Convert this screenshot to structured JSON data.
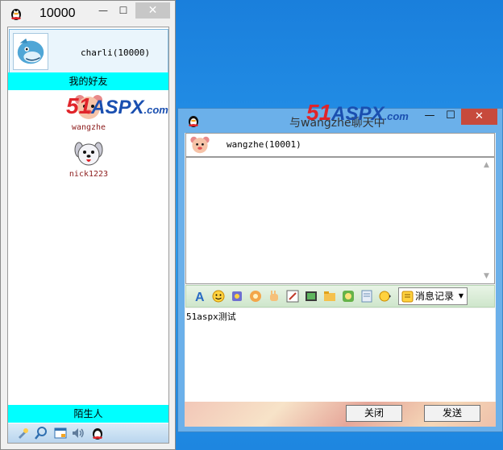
{
  "main_window": {
    "title": "10000",
    "min_label": "—",
    "max_label": "☐",
    "close_label": "✕",
    "me": {
      "name": "charli(10000)"
    },
    "friends_group": "我的好友",
    "friends": [
      {
        "name": "wangzhe"
      },
      {
        "name": "nick1223"
      }
    ],
    "strangers_group": "陌生人",
    "toolbar_icons": [
      "settings-icon",
      "search-icon",
      "manager-icon",
      "volume-icon",
      "qq-icon"
    ]
  },
  "watermarks": [
    {
      "num": "51",
      "brand": "ASPX",
      "suffix": ".com"
    },
    {
      "num": "51",
      "brand": "ASPX",
      "suffix": ".com"
    }
  ],
  "chat_window": {
    "title": "与wangzhe聊天中",
    "min_label": "—",
    "max_label": "☐",
    "close_label": "✕",
    "peer": {
      "name": "wangzhe(10001)"
    },
    "history_button": "消息记录",
    "input_value": "51aspx测试",
    "close_button": "关闭",
    "send_button": "发送",
    "format_icons": [
      "font-icon",
      "emoji-icon",
      "vibrate-icon",
      "magic-icon",
      "hand-icon",
      "edit-icon",
      "image-icon",
      "folder-icon",
      "sticker-icon",
      "template-icon",
      "voice-icon"
    ]
  },
  "colors": {
    "group_bar": "#00ffff",
    "desktop": "#1d8ee6",
    "chat_frame": "#6bb0ea"
  }
}
